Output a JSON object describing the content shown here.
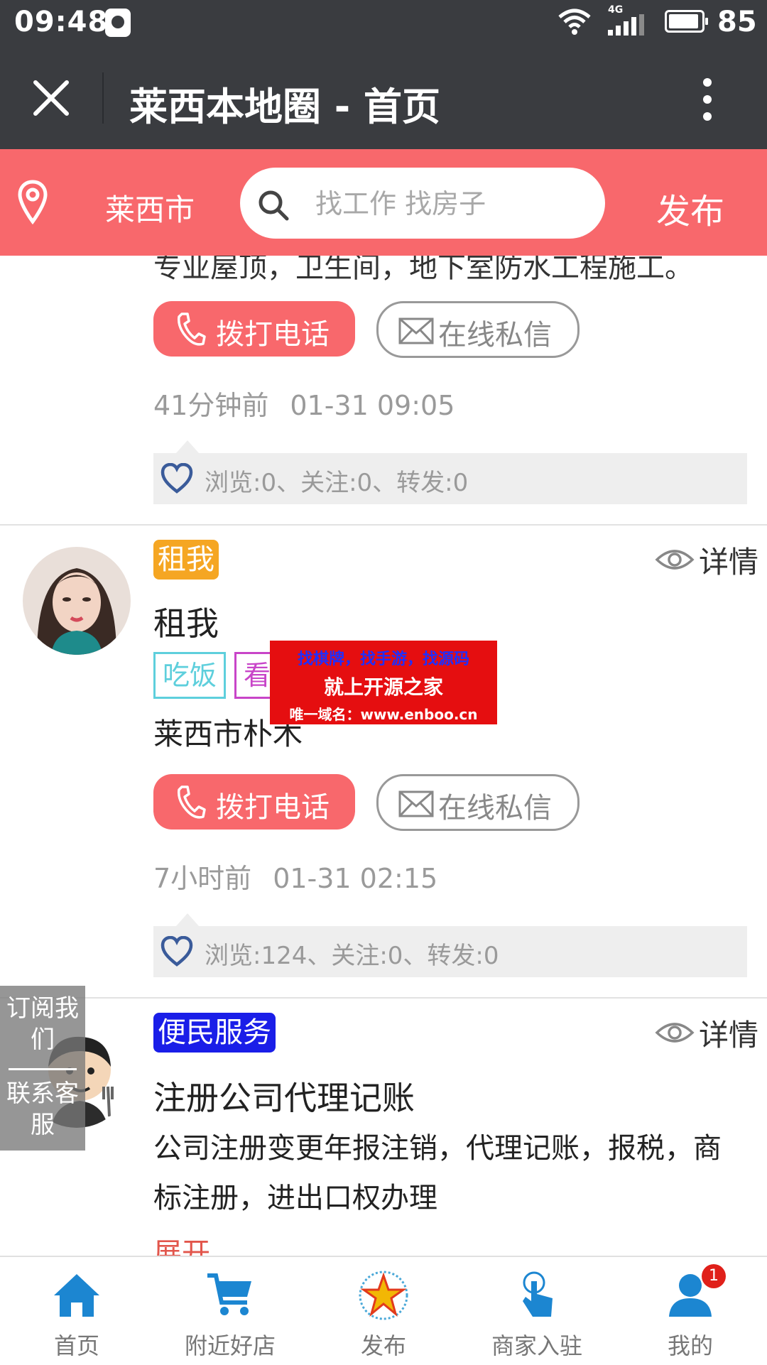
{
  "status_bar": {
    "time": "09:48",
    "network": "4G",
    "battery": "85"
  },
  "title_bar": {
    "title": "莱西本地圈 - 首页"
  },
  "search_bar": {
    "city": "莱西市",
    "placeholder": "找工作 找房子",
    "publish": "发布"
  },
  "post1": {
    "desc_cut": "专业屋顶，卫生间，地下室防水工程施工。",
    "call": "拨打电话",
    "message": "在线私信",
    "ago": "41分钟前",
    "date": "01-31 09:05",
    "stats": "浏览:0、关注:0、转发:0"
  },
  "post2": {
    "category": "租我",
    "details": "详情",
    "title": "租我",
    "tags": [
      "吃饭",
      "看"
    ],
    "location": "莱西市朴木",
    "call": "拨打电话",
    "message": "在线私信",
    "ago": "7小时前",
    "date": "01-31 02:15",
    "stats": "浏览:124、关注:0、转发:0"
  },
  "post3": {
    "category": "便民服务",
    "details": "详情",
    "title": "注册公司代理记账",
    "desc": "公司注册变更年报注销，代理记账，报税，商标注册，进出口权办理",
    "expand": "展开"
  },
  "ad": {
    "line1": "找棋牌，找手游，找源码",
    "line2": "就上开源之家",
    "line3": "唯一域名：www.enboo.cn"
  },
  "float_panel": {
    "subscribe": "订阅我们",
    "service": "联系客服"
  },
  "tab_bar": {
    "items": [
      {
        "label": "首页"
      },
      {
        "label": "附近好店"
      },
      {
        "label": "发布"
      },
      {
        "label": "商家入驻"
      },
      {
        "label": "我的"
      }
    ],
    "mine_badge": "1"
  },
  "colors": {
    "accent": "#f8686c",
    "header": "#3a3c40",
    "tab_icon": "#1c86d1"
  }
}
